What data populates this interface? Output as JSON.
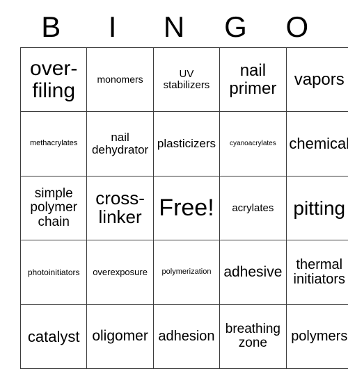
{
  "card": {
    "header": {
      "letters": [
        "B",
        "I",
        "N",
        "G",
        "O"
      ]
    },
    "grid": {
      "columns": 5,
      "rows": 5,
      "free_space_label": "Free!",
      "cells": [
        [
          {
            "text": "over-filing",
            "size": "fs-30"
          },
          {
            "text": "monomers",
            "size": "fs-14"
          },
          {
            "text": "UV stabilizers",
            "size": "fs-15"
          },
          {
            "text": "nail primer",
            "size": "fs-24"
          },
          {
            "text": "vapors",
            "size": "fs-24"
          }
        ],
        [
          {
            "text": "methacrylates",
            "size": "fs-11"
          },
          {
            "text": "nail dehydrator",
            "size": "fs-17"
          },
          {
            "text": "plasticizers",
            "size": "fs-17"
          },
          {
            "text": "cyanoacrylates",
            "size": "fs-10"
          },
          {
            "text": "chemical",
            "size": "fs-22"
          }
        ],
        [
          {
            "text": "simple polymer chain",
            "size": "fs-19"
          },
          {
            "text": "cross-linker",
            "size": "fs-26"
          },
          {
            "text": "Free!",
            "size": "fs-34"
          },
          {
            "text": "acrylates",
            "size": "fs-15"
          },
          {
            "text": "pitting",
            "size": "fs-28"
          }
        ],
        [
          {
            "text": "photoinitiators",
            "size": "fs-12"
          },
          {
            "text": "overexposure",
            "size": "fs-13"
          },
          {
            "text": "polymerization",
            "size": "fs-11"
          },
          {
            "text": "adhesive",
            "size": "fs-21"
          },
          {
            "text": "thermal initiators",
            "size": "fs-20"
          }
        ],
        [
          {
            "text": "catalyst",
            "size": "fs-22"
          },
          {
            "text": "oligomer",
            "size": "fs-21"
          },
          {
            "text": "adhesion",
            "size": "fs-20"
          },
          {
            "text": "breathing zone",
            "size": "fs-19"
          },
          {
            "text": "polymers",
            "size": "fs-20"
          }
        ]
      ]
    },
    "colors": {
      "background": "#ffffff",
      "text": "#000000",
      "border": "#3c3c3c"
    }
  }
}
